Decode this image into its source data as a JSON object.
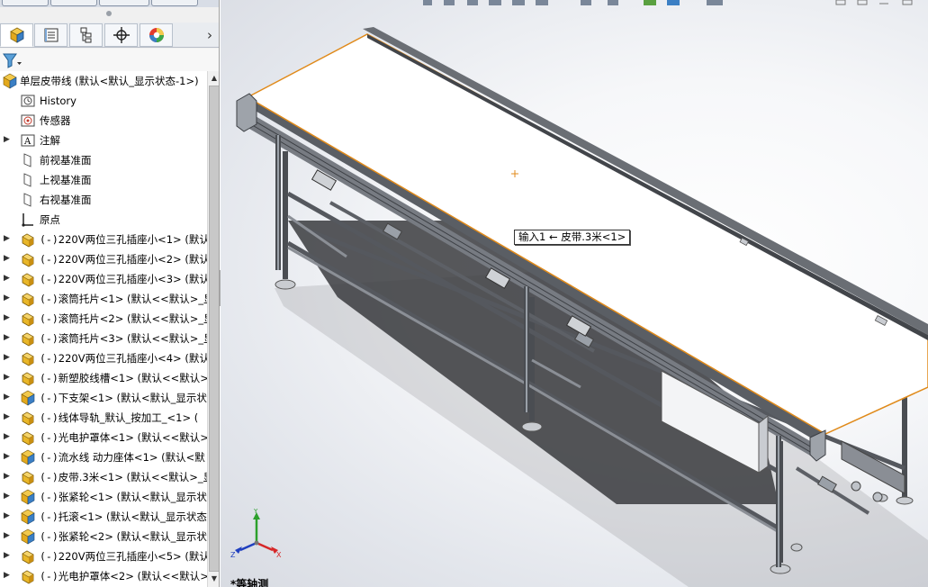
{
  "viewport": {
    "mate_tooltip": "输入1 ← 皮带.3米<1>",
    "view_label": "*等轴测",
    "triad": {
      "x": "X",
      "y": "Y",
      "z": "Z"
    }
  },
  "feature_manager": {
    "tabs": [
      {
        "name": "FeatureManager设计树",
        "icon": "feature-manager-icon"
      },
      {
        "name": "PropertyManager",
        "icon": "property-manager-icon"
      },
      {
        "name": "ConfigurationManager",
        "icon": "configuration-manager-icon"
      },
      {
        "name": "DimXpertManager",
        "icon": "dimxpert-icon"
      },
      {
        "name": "DisplayManager",
        "icon": "display-manager-icon"
      }
    ],
    "root": "单层皮带线  (默认<默认_显示状态-1>)",
    "items": [
      {
        "prefix": "",
        "label": "History",
        "icon": "history-icon",
        "expandable": false
      },
      {
        "prefix": "",
        "label": "传感器",
        "icon": "sensor-icon",
        "expandable": false
      },
      {
        "prefix": "",
        "label": "注解",
        "icon": "annotation-icon",
        "expandable": true
      },
      {
        "prefix": "",
        "label": "前视基准面",
        "icon": "plane-icon",
        "expandable": false
      },
      {
        "prefix": "",
        "label": "上视基准面",
        "icon": "plane-icon",
        "expandable": false
      },
      {
        "prefix": "",
        "label": "右视基准面",
        "icon": "plane-icon",
        "expandable": false
      },
      {
        "prefix": "",
        "label": "原点",
        "icon": "origin-icon",
        "expandable": false
      },
      {
        "prefix": "(-)",
        "label": "220V两位三孔插座小<1>  (默认",
        "icon": "part-icon",
        "expandable": true
      },
      {
        "prefix": "(-)",
        "label": "220V两位三孔插座小<2>  (默认",
        "icon": "part-icon",
        "expandable": true
      },
      {
        "prefix": "(-)",
        "label": "220V两位三孔插座小<3>  (默认",
        "icon": "part-icon",
        "expandable": true
      },
      {
        "prefix": "(-)",
        "label": "滚筒托片<1>  (默认<<默认>_显",
        "icon": "part-icon",
        "expandable": true
      },
      {
        "prefix": "(-)",
        "label": "滚筒托片<2>  (默认<<默认>_显",
        "icon": "part-icon",
        "expandable": true
      },
      {
        "prefix": "(-)",
        "label": "滚筒托片<3>  (默认<<默认>_显",
        "icon": "part-icon",
        "expandable": true
      },
      {
        "prefix": "(-)",
        "label": "220V两位三孔插座小<4>  (默认",
        "icon": "part-icon",
        "expandable": true
      },
      {
        "prefix": "(-)",
        "label": "新塑胶线槽<1>  (默认<<默认>_",
        "icon": "part-icon",
        "expandable": true
      },
      {
        "prefix": "(-)",
        "label": "下支架<1>  (默认<默认_显示状",
        "icon": "assembly-icon",
        "expandable": true
      },
      {
        "prefix": "(-)",
        "label": "线体导轨_默认_按加工_<1>  (",
        "icon": "part-icon",
        "expandable": true
      },
      {
        "prefix": "(-)",
        "label": "光电护罩体<1>  (默认<<默认>_",
        "icon": "part-icon",
        "expandable": true
      },
      {
        "prefix": "(-)",
        "label": "流水线 动力座体<1>  (默认<默",
        "icon": "assembly-icon",
        "expandable": true
      },
      {
        "prefix": "(-)",
        "label": "皮带.3米<1>  (默认<<默认>_显",
        "icon": "part-icon",
        "expandable": true
      },
      {
        "prefix": "(-)",
        "label": "张紧轮<1>  (默认<默认_显示状",
        "icon": "assembly-icon",
        "expandable": true
      },
      {
        "prefix": "(-)",
        "label": "托滚<1>  (默认<默认_显示状态",
        "icon": "assembly-icon",
        "expandable": true
      },
      {
        "prefix": "(-)",
        "label": "张紧轮<2>  (默认<默认_显示状",
        "icon": "assembly-icon",
        "expandable": true
      },
      {
        "prefix": "(-)",
        "label": "220V两位三孔插座小<5>  (默认",
        "icon": "part-icon",
        "expandable": true
      },
      {
        "prefix": "(-)",
        "label": "光电护罩体<2>  (默认<<默认>_",
        "icon": "part-icon",
        "expandable": true
      }
    ]
  },
  "colors": {
    "part_icon": "#e8b628",
    "assembly_icon": "#3b7fc4",
    "selection_edge": "#e08a1a",
    "frame": "#4a4d52",
    "belt": "#ffffff"
  }
}
